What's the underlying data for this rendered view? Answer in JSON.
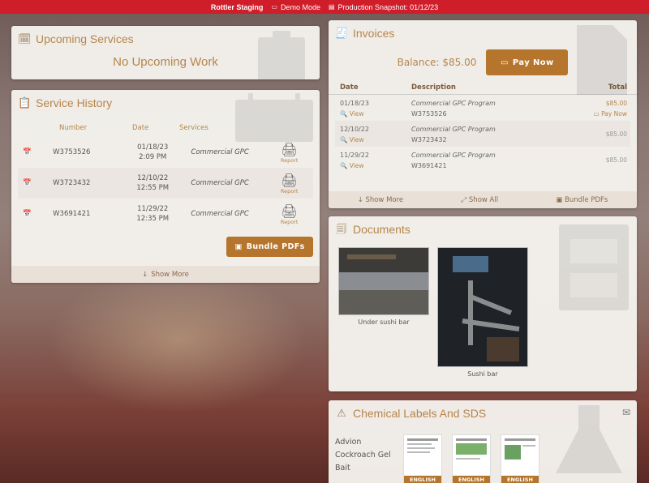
{
  "topbar": {
    "brand": "Rottler Staging",
    "demo_mode": "Demo Mode",
    "snapshot": "Production Snapshot: 01/12/23"
  },
  "upcoming": {
    "title": "Upcoming Services",
    "empty_text": "No Upcoming Work"
  },
  "history": {
    "title": "Service History",
    "columns": [
      "Number",
      "Date",
      "Services"
    ],
    "rows": [
      {
        "number": "W3753526",
        "date": "01/18/23",
        "time": "2:09 PM",
        "service": "Commercial GPC",
        "report": "Report"
      },
      {
        "number": "W3723432",
        "date": "12/10/22",
        "time": "12:55 PM",
        "service": "Commercial GPC",
        "report": "Report"
      },
      {
        "number": "W3691421",
        "date": "11/29/22",
        "time": "12:35 PM",
        "service": "Commercial GPC",
        "report": "Report"
      }
    ],
    "bundle_label": "Bundle PDFs",
    "show_more": "Show More"
  },
  "invoices": {
    "title": "Invoices",
    "balance": "Balance: $85.00",
    "pay_label": "Pay Now",
    "columns": {
      "date": "Date",
      "description": "Description",
      "total": "Total"
    },
    "rows": [
      {
        "date": "01/18/23",
        "view": "View",
        "desc": "Commercial GPC Program",
        "wo": "W3753526",
        "total": "$85.00",
        "pay": "Pay Now"
      },
      {
        "date": "12/10/22",
        "view": "View",
        "desc": "Commercial GPC Program",
        "wo": "W3723432",
        "total": "$85.00",
        "pay": ""
      },
      {
        "date": "11/29/22",
        "view": "View",
        "desc": "Commercial GPC Program",
        "wo": "W3691421",
        "total": "$85.00",
        "pay": ""
      }
    ],
    "footer": {
      "show_more": "Show More",
      "show_all": "Show All",
      "bundle": "Bundle PDFs"
    }
  },
  "documents": {
    "title": "Documents",
    "items": [
      {
        "caption": "Under sushi bar"
      },
      {
        "caption": "Sushi bar"
      }
    ]
  },
  "chemical": {
    "title": "Chemical Labels And SDS",
    "product": "Advion Cockroach Gel Bait",
    "labels": [
      "ENGLISH",
      "ENGLISH",
      "ENGLISH"
    ]
  }
}
